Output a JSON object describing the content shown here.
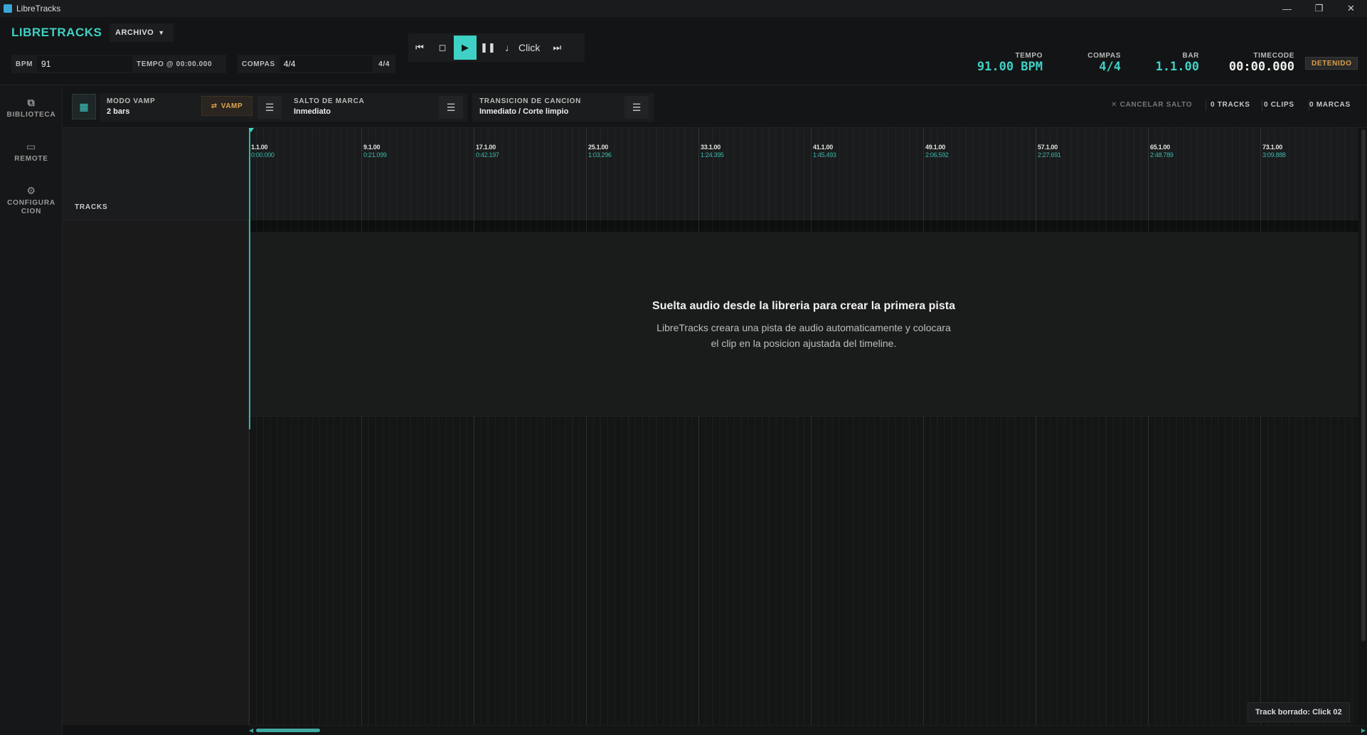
{
  "window": {
    "title": "LibreTracks",
    "controls": [
      "minimize",
      "restore",
      "close"
    ]
  },
  "brand": "LIBRETRACKS",
  "menu": {
    "archivo": "ARCHIVO"
  },
  "fields": {
    "bpm_label": "BPM",
    "bpm_value": "91",
    "tempo_label": "TEMPO @ 00:00.000",
    "compas_label": "COMPAS",
    "compas_value": "4/4",
    "compas_suffix": "4/4"
  },
  "transport": {
    "click_label": "Click"
  },
  "stats": {
    "tempo": {
      "label": "TEMPO",
      "value": "91.00 BPM"
    },
    "compas": {
      "label": "COMPAS",
      "value": "4/4"
    },
    "bar": {
      "label": "BAR",
      "value": "1.1.00"
    },
    "timecode": {
      "label": "TIMECODE",
      "value": "00:00.000"
    },
    "status": "DETENIDO"
  },
  "rail": [
    {
      "label_line1": "BIBLIOTECA",
      "label_line2": "",
      "icon": "library-icon"
    },
    {
      "label_line1": "REMOTE",
      "label_line2": "",
      "icon": "remote-icon"
    },
    {
      "label_line1": "CONFIGURA",
      "label_line2": "CION",
      "icon": "gear-icon"
    }
  ],
  "controls": {
    "vamp": {
      "title": "MODO VAMP",
      "value": "2 bars",
      "button": "VAMP"
    },
    "salto": {
      "title": "SALTO DE MARCA",
      "value": "Inmediato"
    },
    "transicion": {
      "title": "TRANSICION DE CANCION",
      "value": "Inmediato / Corte limpio"
    },
    "cancelar": "CANCELAR SALTO",
    "tracks_count": "0 TRACKS",
    "clips_count": "0 CLIPS",
    "marcas_count": "0 MARCAS"
  },
  "track_header": "TRACKS",
  "markers": [
    {
      "bar": "1.1.00",
      "time": "0:00.000"
    },
    {
      "bar": "9.1.00",
      "time": "0:21.099"
    },
    {
      "bar": "17.1.00",
      "time": "0:42.197"
    },
    {
      "bar": "25.1.00",
      "time": "1:03.296"
    },
    {
      "bar": "33.1.00",
      "time": "1:24.395"
    },
    {
      "bar": "41.1.00",
      "time": "1:45.493"
    },
    {
      "bar": "49.1.00",
      "time": "2:06.592"
    },
    {
      "bar": "57.1.00",
      "time": "2:27.691"
    },
    {
      "bar": "65.1.00",
      "time": "2:48.789"
    },
    {
      "bar": "73.1.00",
      "time": "3:09.888"
    }
  ],
  "empty_state": {
    "title": "Suelta audio desde la libreria para crear la primera pista",
    "line1": "LibreTracks creara una pista de audio automaticamente y colocara",
    "line2": "el clip en la posicion ajustada del timeline."
  },
  "toast": "Track borrado: Click 02",
  "colors": {
    "accent": "#3fd1c5",
    "vamp": "#e0a650",
    "status": "#d9a04a"
  }
}
